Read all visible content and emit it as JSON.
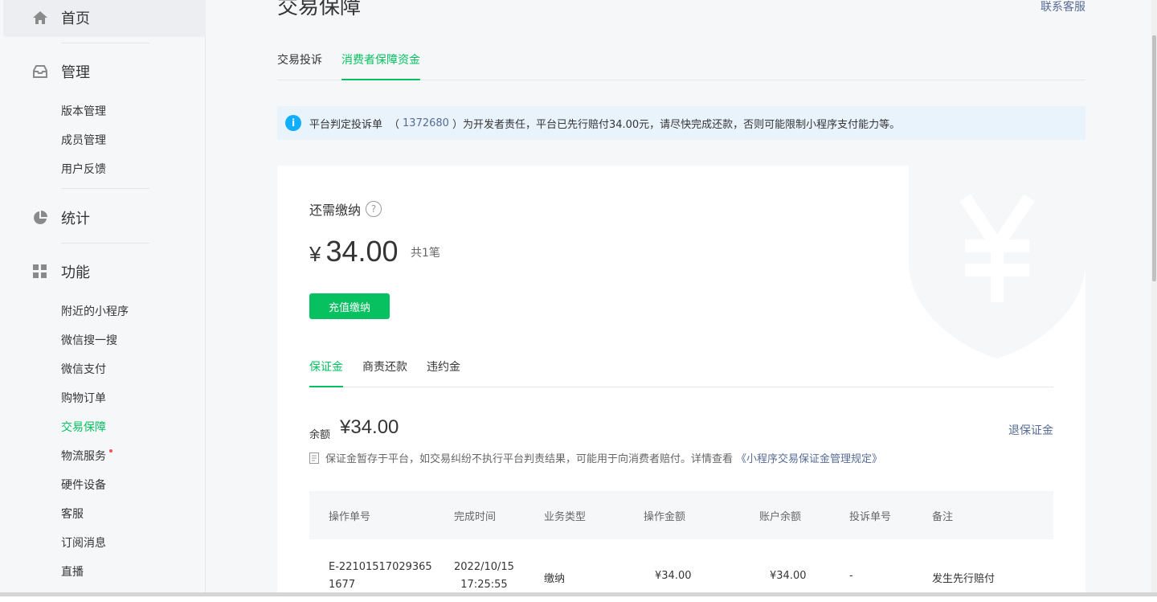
{
  "sidebar": {
    "home": "首页",
    "manage": "管理",
    "manage_items": [
      "版本管理",
      "成员管理",
      "用户反馈"
    ],
    "stats": "统计",
    "features": "功能",
    "feature_items": [
      "附近的小程序",
      "微信搜一搜",
      "微信支付",
      "购物订单",
      "交易保障",
      "物流服务",
      "硬件设备",
      "客服",
      "订阅消息",
      "直播"
    ],
    "active_item": "交易保障"
  },
  "header": {
    "title": "交易保障",
    "contact": "联系客服"
  },
  "tabs": [
    "交易投诉",
    "消费者保障资金"
  ],
  "notice": {
    "prefix": "平台判定投诉单",
    "open_paren": "（",
    "complaint_id": "1372680",
    "close_paren": "）",
    "suffix": "为开发者责任，平台已先行赔付34.00元，请尽快完成还款，否则可能限制小程序支付能力等。"
  },
  "due": {
    "label": "还需缴纳",
    "currency": "¥",
    "amount": "34.00",
    "count": "共1笔",
    "button": "充值缴纳"
  },
  "subtabs": [
    "保证金",
    "商责还款",
    "违约金"
  ],
  "balance": {
    "label": "余额",
    "amount": "¥34.00",
    "refund": "退保证金",
    "desc": "保证金暂存于平台，如交易纠纷不执行平台判责结果，可能用于向消费者赔付。详情查看",
    "desc_link": "《小程序交易保证金管理规定》"
  },
  "table": {
    "headers": [
      "操作单号",
      "完成时间",
      "业务类型",
      "操作金额",
      "账户余额",
      "投诉单号",
      "备注"
    ],
    "rows": [
      {
        "id_line1": "E-22101517029365",
        "id_line2": "1677",
        "date": "2022/10/15",
        "time": "17:25:55",
        "type": "缴纳",
        "amount": "¥34.00",
        "balance": "¥34.00",
        "complaint": "-",
        "remark": "发生先行赔付"
      }
    ]
  },
  "colors": {
    "accent": "#07c160",
    "link": "#576b95",
    "info": "#10aeff"
  }
}
